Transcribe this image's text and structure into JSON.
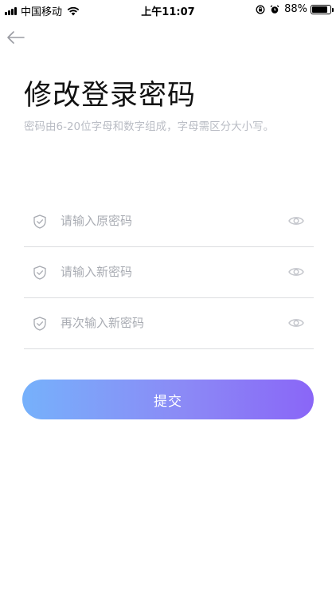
{
  "status_bar": {
    "carrier": "中国移动",
    "time": "上午11:07",
    "battery_percent": "88%",
    "battery_level": 0.88,
    "icons": [
      "signal-icon",
      "wifi-icon",
      "rotation-lock-icon",
      "alarm-icon",
      "battery-icon"
    ]
  },
  "nav": {
    "back_icon": "back-arrow-icon"
  },
  "header": {
    "title": "修改登录密码",
    "hint": "密码由6-20位字母和数字组成，字母需区分大小写。"
  },
  "form": {
    "fields": [
      {
        "placeholder": "请输入原密码",
        "value": "",
        "icon": "shield-icon",
        "toggle_icon": "eye-icon"
      },
      {
        "placeholder": "请输入新密码",
        "value": "",
        "icon": "shield-icon",
        "toggle_icon": "eye-icon"
      },
      {
        "placeholder": "再次输入新密码",
        "value": "",
        "icon": "shield-icon",
        "toggle_icon": "eye-icon"
      }
    ],
    "submit_label": "提交"
  },
  "colors": {
    "button_gradient_start": "#76b1fb",
    "button_gradient_end": "#8a66f7",
    "hint_text": "#b9bcc4",
    "divider": "#dcdde0"
  }
}
